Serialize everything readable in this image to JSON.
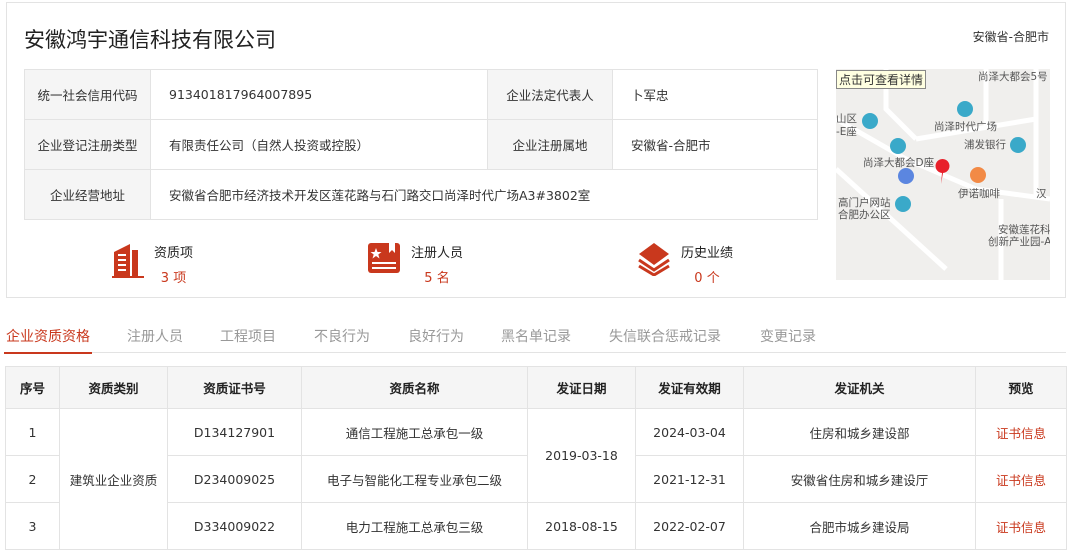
{
  "company": {
    "name": "安徽鸿宇通信科技有限公司",
    "region": "安徽省-合肥市"
  },
  "info": [
    {
      "k1": "统一社会信用代码",
      "v1": "913401817964007895",
      "k2": "企业法定代表人",
      "v2": "卜军忠"
    },
    {
      "k1": "企业登记注册类型",
      "v1": "有限责任公司（自然人投资或控股）",
      "k2": "企业注册属地",
      "v2": "安徽省-合肥市"
    },
    {
      "k1": "企业经营地址",
      "v1": "安徽省合肥市经济技术开发区莲花路与石门路交口尚泽时代广场A3#3802室"
    }
  ],
  "stats": [
    {
      "label": "资质项",
      "value": "3 项",
      "icon": "building-icon"
    },
    {
      "label": "注册人员",
      "value": "5 名",
      "icon": "certificate-icon"
    },
    {
      "label": "历史业绩",
      "value": "0 个",
      "icon": "layers-icon"
    }
  ],
  "map": {
    "tooltip": "点击可查看详情",
    "labels": [
      "尚泽大都会5号",
      "山区",
      "-E座",
      "尚泽时代广场",
      "浦发银行",
      "尚泽大都会D座",
      "伊诺咖啡",
      "汉",
      "高门户网站",
      "合肥办公区",
      "安徽莲花科",
      "创新产业园-A"
    ]
  },
  "tabs": [
    "企业资质资格",
    "注册人员",
    "工程项目",
    "不良行为",
    "良好行为",
    "黑名单记录",
    "失信联合惩戒记录",
    "变更记录"
  ],
  "table": {
    "headers": [
      "序号",
      "资质类别",
      "资质证书号",
      "资质名称",
      "发证日期",
      "发证有效期",
      "发证机关",
      "预览"
    ],
    "category": "建筑业企业资质",
    "rows": [
      {
        "no": "1",
        "cert": "D134127901",
        "name": "通信工程施工总承包一级",
        "expiry": "2024-03-04",
        "authority": "住房和城乡建设部",
        "preview": "证书信息"
      },
      {
        "no": "2",
        "cert": "D234009025",
        "name": "电子与智能化工程专业承包二级",
        "expiry": "2021-12-31",
        "authority": "安徽省住房和城乡建设厅",
        "preview": "证书信息"
      },
      {
        "no": "3",
        "cert": "D334009022",
        "name": "电力工程施工总承包三级",
        "issue": "2018-08-15",
        "expiry": "2022-02-07",
        "authority": "合肥市城乡建设局",
        "preview": "证书信息"
      }
    ],
    "merged_issue": "2019-03-18"
  },
  "colors": {
    "accent": "#c9381d"
  }
}
